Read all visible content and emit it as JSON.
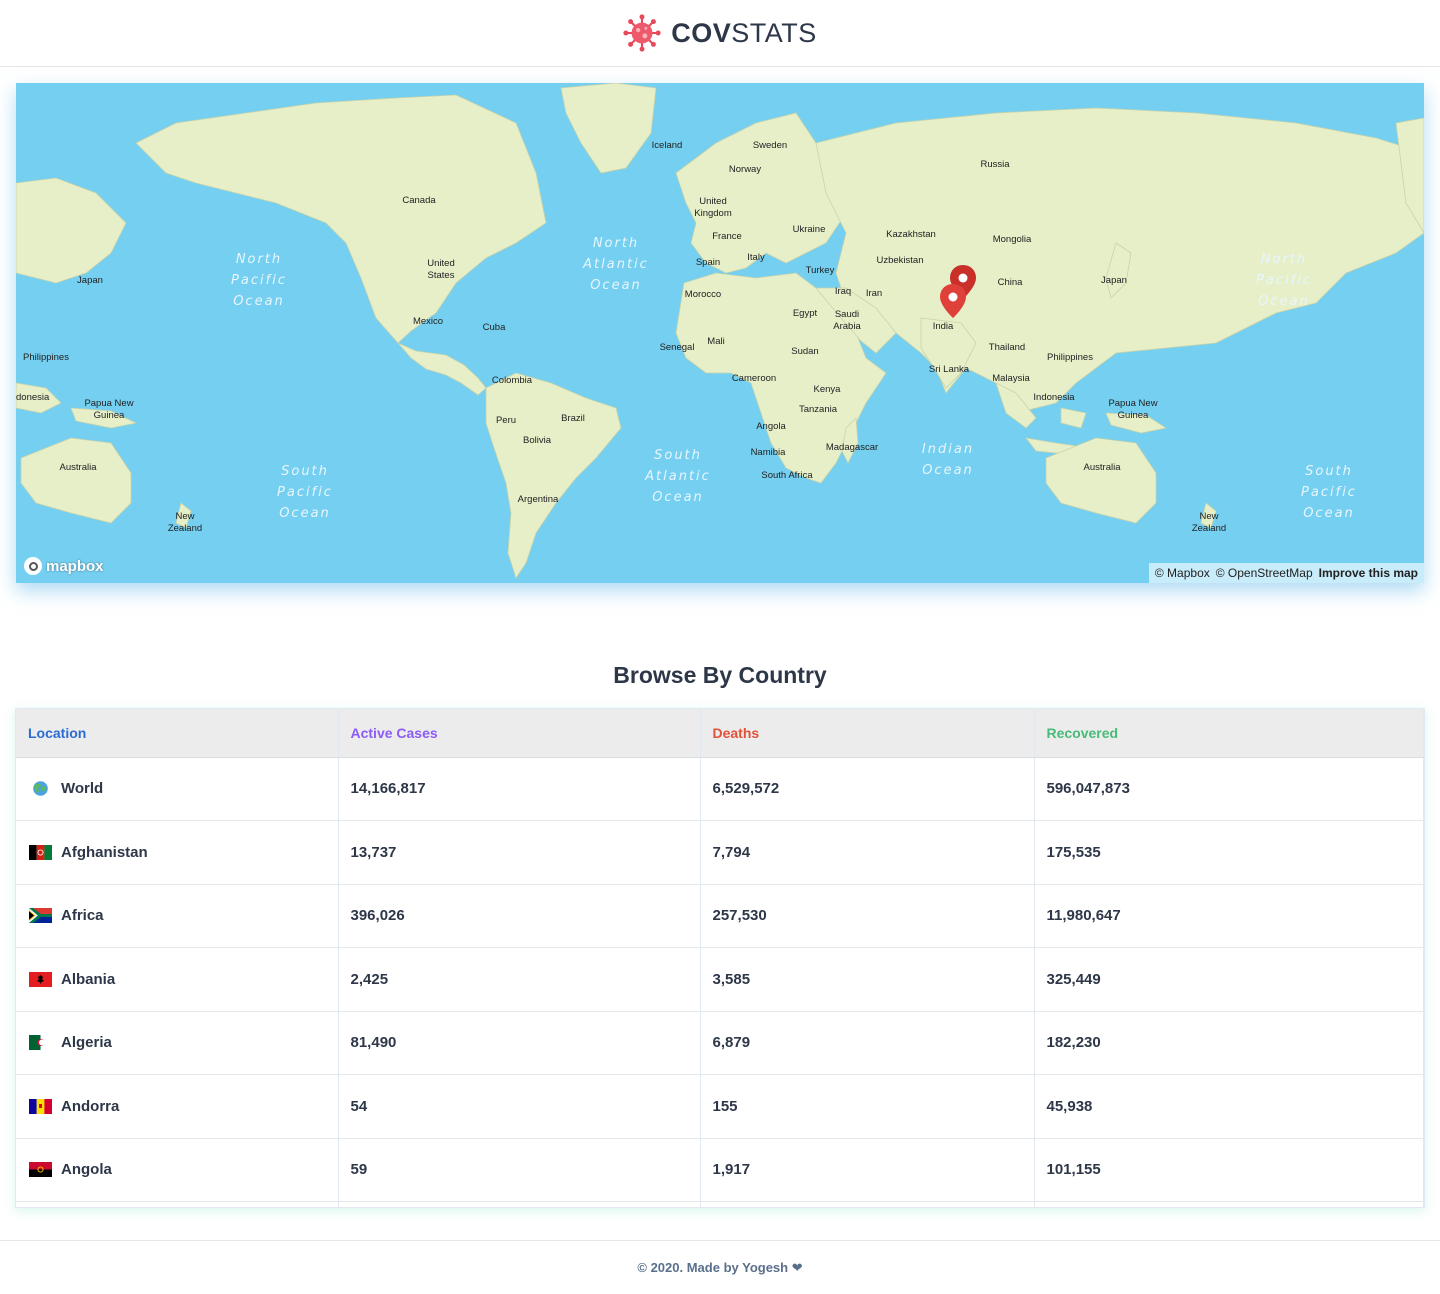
{
  "brand": {
    "bold": "COV",
    "light": "STATS"
  },
  "map": {
    "attribution_mapbox": "© Mapbox",
    "attribution_osm": "© OpenStreetMap",
    "improve": "Improve this map",
    "logo": "mapbox",
    "labels": {
      "canada": "Canada",
      "us_1": "United",
      "us_2": "States",
      "mexico": "Mexico",
      "cuba": "Cuba",
      "colombia": "Colombia",
      "peru": "Peru",
      "brazil": "Brazil",
      "bolivia": "Bolivia",
      "argentina": "Argentina",
      "iceland": "Iceland",
      "sweden": "Sweden",
      "norway": "Norway",
      "uk_1": "United",
      "uk_2": "Kingdom",
      "france": "France",
      "spain": "Spain",
      "italy": "Italy",
      "ukraine": "Ukraine",
      "turkey": "Turkey",
      "morocco": "Morocco",
      "egypt": "Egypt",
      "iraq": "Iraq",
      "iran": "Iran",
      "saudi_1": "Saudi",
      "saudi_2": "Arabia",
      "mali": "Mali",
      "senegal": "Senegal",
      "sudan": "Sudan",
      "cameroon": "Cameroon",
      "kenya": "Kenya",
      "tanzania": "Tanzania",
      "angola": "Angola",
      "namibia": "Namibia",
      "south_africa": "South Africa",
      "madagascar": "Madagascar",
      "russia": "Russia",
      "kazakhstan": "Kazakhstan",
      "uzbekistan": "Uzbekistan",
      "mongolia": "Mongolia",
      "china": "China",
      "india": "India",
      "sri_lanka": "Sri Lanka",
      "thailand": "Thailand",
      "malaysia": "Malaysia",
      "indonesia": "Indonesia",
      "indonesia_left": "donesia",
      "philippines": "Philippines",
      "japan": "Japan",
      "png_1": "Papua New",
      "png_2": "Guinea",
      "australia": "Australia",
      "nz_1": "New",
      "nz_2": "Zealand"
    },
    "oceans": {
      "north": "North",
      "south": "South",
      "pacific": "Pacific",
      "atlantic": "Atlantic",
      "ocean": "Ocean",
      "indian": "Indian"
    }
  },
  "section_title": "Browse By Country",
  "table": {
    "headers": {
      "location": "Location",
      "active": "Active Cases",
      "deaths": "Deaths",
      "recovered": "Recovered"
    },
    "rows": [
      {
        "location": "World",
        "flag": "globe-icon",
        "active": "14,166,817",
        "deaths": "6,529,572",
        "recovered": "596,047,873"
      },
      {
        "location": "Afghanistan",
        "flag": "afghanistan-flag",
        "active": "13,737",
        "deaths": "7,794",
        "recovered": "175,535"
      },
      {
        "location": "Africa",
        "flag": "south-africa-flag",
        "active": "396,026",
        "deaths": "257,530",
        "recovered": "11,980,647"
      },
      {
        "location": "Albania",
        "flag": "albania-flag",
        "active": "2,425",
        "deaths": "3,585",
        "recovered": "325,449"
      },
      {
        "location": "Algeria",
        "flag": "algeria-flag",
        "active": "81,490",
        "deaths": "6,879",
        "recovered": "182,230"
      },
      {
        "location": "Andorra",
        "flag": "andorra-flag",
        "active": "54",
        "deaths": "155",
        "recovered": "45,938"
      },
      {
        "location": "Angola",
        "flag": "angola-flag",
        "active": "59",
        "deaths": "1,917",
        "recovered": "101,155"
      }
    ]
  },
  "footer": {
    "text": "© 2020. Made by Yogesh ❤"
  },
  "colors": {
    "ocean": "#75cff0",
    "land": "#e7efc9",
    "header_location": "#2b6cd4",
    "header_active": "#8b5cf6",
    "header_deaths": "#e0523a",
    "header_recovered": "#48bb78",
    "marker": "#d9312b"
  }
}
